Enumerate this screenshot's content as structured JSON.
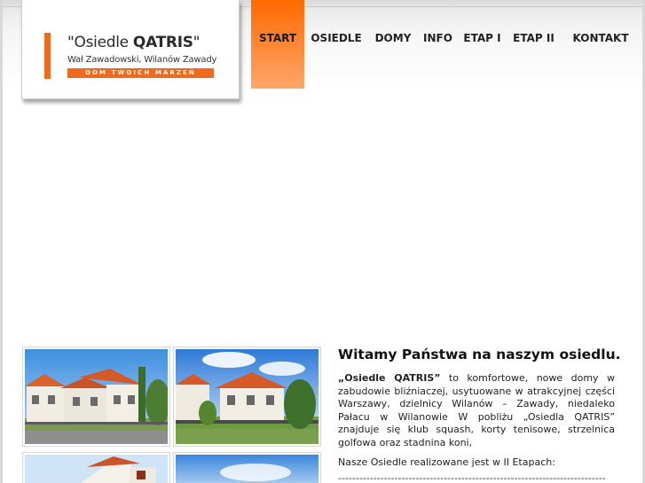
{
  "logo": {
    "title_prefix": "\"Osiedle ",
    "title_bold": "QATRIS",
    "title_suffix": "\"",
    "subtitle": "Wał Zawadowski, Wilanów Zawady",
    "slogan": "DOM TWOICH MARZEŃ",
    "accent_color": "#ef6a1e"
  },
  "nav": {
    "items": [
      {
        "label": "START",
        "active": true
      },
      {
        "label": "OSIEDLE",
        "active": false
      },
      {
        "label": "DOMY",
        "active": false
      },
      {
        "label": "INFO",
        "active": false
      },
      {
        "label": "ETAP I",
        "active": false
      },
      {
        "label": "ETAP II",
        "active": false
      },
      {
        "label": "KONTAKT",
        "active": false
      }
    ],
    "active_color": "#ff6a00"
  },
  "main": {
    "welcome": "Witamy Państwa na naszym osiedlu.",
    "intro_bold": "„Osiedle QATRIS”",
    "intro_text": " to komfortowe, nowe domy w zabudowie bliźniaczej, usytuowane w atrakcyjnej części Warszawy, dzielnicy Wilanów – Zawady, niedaleko Pałacu w Wilanowie W pobliżu „Osiedla QATRIS” znajduje się klub squash, korty tenisowe, strzelnica golfowa oraz stadnina koni,",
    "stages_text": "Nasze Osiedle realizowane jest w II Etapach:",
    "separator": "----------------------------------------------------------------------------"
  },
  "gallery": {
    "photos": [
      {
        "icon": "house-photo-icon"
      },
      {
        "icon": "house-photo-icon"
      },
      {
        "icon": "house-photo-icon"
      },
      {
        "icon": "house-photo-icon"
      }
    ]
  }
}
